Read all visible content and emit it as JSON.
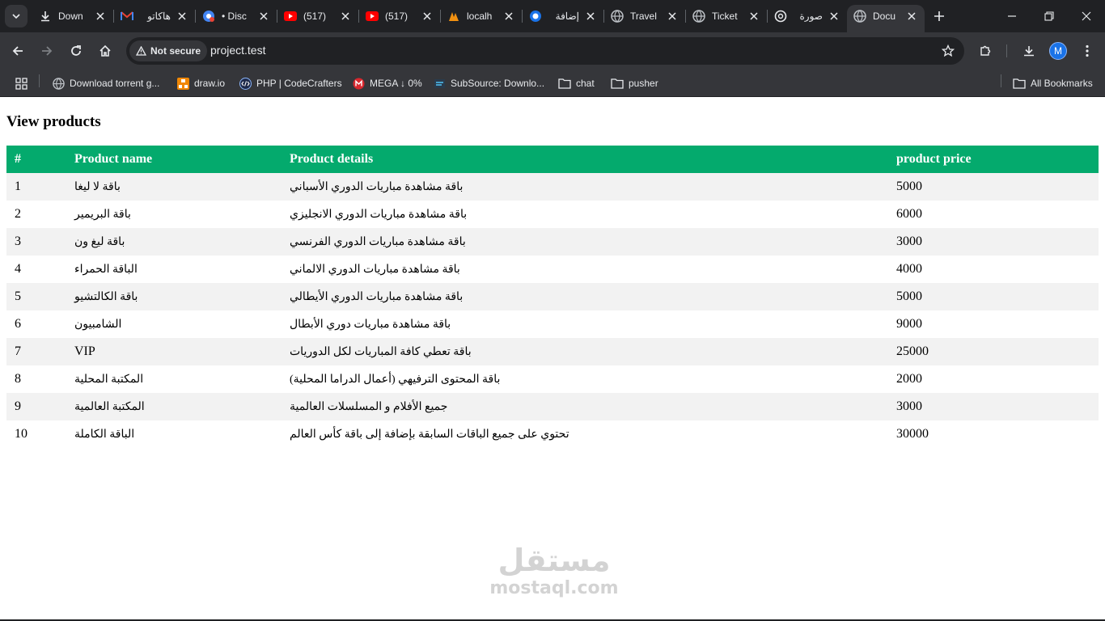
{
  "browser": {
    "tabs": [
      {
        "title": "Down",
        "icon": "download-icon"
      },
      {
        "title": "هاكاتو",
        "icon": "gmail-icon"
      },
      {
        "title": "• Disc",
        "icon": "chrome-icon"
      },
      {
        "title": "(517)",
        "icon": "youtube-icon"
      },
      {
        "title": "(517)",
        "icon": "youtube-icon"
      },
      {
        "title": "localh",
        "icon": "phpmyadmin-icon"
      },
      {
        "title": "إضافة",
        "icon": "blue-dot-icon"
      },
      {
        "title": "Travel",
        "icon": "globe-icon"
      },
      {
        "title": "Ticket",
        "icon": "globe-icon"
      },
      {
        "title": "صورة",
        "icon": "openai-icon"
      },
      {
        "title": "Docu",
        "icon": "globe-icon",
        "active": true
      }
    ],
    "security_label": "Not secure",
    "url": "project.test",
    "profile_initial": "M",
    "bookmarks": [
      {
        "label": "Download torrent g...",
        "icon": "globe-icon"
      },
      {
        "label": "draw.io",
        "icon": "drawio-icon"
      },
      {
        "label": "PHP | CodeCrafters",
        "icon": "code-icon"
      },
      {
        "label": "MEGA ↓ 0%",
        "icon": "mega-icon"
      },
      {
        "label": "SubSource: Downlo...",
        "icon": "subsource-icon"
      },
      {
        "label": "chat",
        "icon": "folder-icon"
      },
      {
        "label": "pusher",
        "icon": "folder-icon"
      }
    ],
    "all_bookmarks_label": "All Bookmarks"
  },
  "page": {
    "title": "View products",
    "table": {
      "headers": [
        "#",
        "Product name",
        "Product details",
        "product price"
      ],
      "rows": [
        [
          "1",
          "باقة لا ليغا",
          "باقة مشاهدة مباريات الدوري الأسباني",
          "5000"
        ],
        [
          "2",
          "باقة البريمير",
          "باقة مشاهدة مباريات الدوري الانجليزي",
          "6000"
        ],
        [
          "3",
          "باقة ليغ ون",
          "باقة مشاهدة مباريات الدوري الفرنسي",
          "3000"
        ],
        [
          "4",
          "الباقة الحمراء",
          "باقة مشاهدة مباريات الدوري الالماني",
          "4000"
        ],
        [
          "5",
          "باقة الكالتشيو",
          "باقة مشاهدة مباريات الدوري الأيطالي",
          "5000"
        ],
        [
          "6",
          "الشامبيون",
          "باقة مشاهدة مباريات دوري الأبطال",
          "9000"
        ],
        [
          "7",
          "VIP",
          "باقة تعطي كافة المباريات لكل الدوريات",
          "25000"
        ],
        [
          "8",
          "المكتبة المحلية",
          "باقة المحتوى الترفيهي (أعمال الدراما المحلية)",
          "2000"
        ],
        [
          "9",
          "المكتبة العالمية",
          "جميع الأفلام و المسلسلات العالمية",
          "3000"
        ],
        [
          "10",
          "الباقة الكاملة",
          "تحتوي على جميع الباقات السابقة بإضافة إلى باقة كأس العالم",
          "30000"
        ]
      ]
    }
  },
  "watermark": {
    "arabic": "مستقل",
    "latin": "mostaql.com"
  },
  "colors": {
    "header_bg": "#04aa6d",
    "stripe": "#f2f2f2",
    "chrome_dark": "#202124",
    "chrome_mid": "#35363a"
  }
}
